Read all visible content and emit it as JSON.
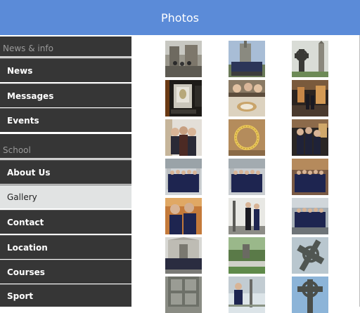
{
  "header": {
    "title": "Photos"
  },
  "sidebar": {
    "sections": [
      {
        "label": "News & info"
      },
      {
        "label": "School"
      }
    ],
    "items": [
      {
        "label": "News"
      },
      {
        "label": "Messages"
      },
      {
        "label": "Events"
      },
      {
        "label": "About Us"
      },
      {
        "label": "Gallery",
        "selected": true
      },
      {
        "label": "Contact"
      },
      {
        "label": "Location"
      },
      {
        "label": "Courses"
      },
      {
        "label": "Sport"
      }
    ]
  },
  "gallery": {
    "thumbnails": [
      {
        "icon": "photo-ruins-group"
      },
      {
        "icon": "photo-group-outdoor"
      },
      {
        "icon": "photo-high-cross-tower"
      },
      {
        "icon": "photo-museum-display"
      },
      {
        "icon": "photo-table-group"
      },
      {
        "icon": "photo-museum-hall"
      },
      {
        "icon": "photo-students-indoor"
      },
      {
        "icon": "photo-gold-collar"
      },
      {
        "icon": "photo-students-exhibit"
      },
      {
        "icon": "photo-uniform-group"
      },
      {
        "icon": "photo-uniform-group"
      },
      {
        "icon": "photo-uniform-group"
      },
      {
        "icon": "photo-students-seated"
      },
      {
        "icon": "photo-students-gate"
      },
      {
        "icon": "photo-uniform-group"
      },
      {
        "icon": "photo-building-group"
      },
      {
        "icon": "photo-park-memorial"
      },
      {
        "icon": "photo-celtic-cross"
      },
      {
        "icon": "photo-carved-stone"
      },
      {
        "icon": "photo-students-trees"
      },
      {
        "icon": "photo-high-cross"
      }
    ]
  }
}
